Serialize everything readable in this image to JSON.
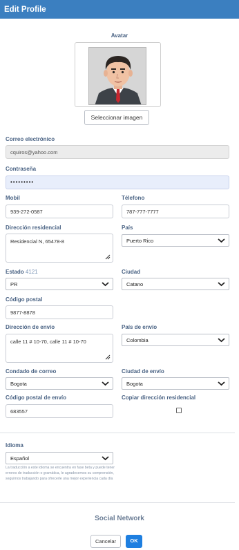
{
  "header": {
    "title": "Edit Profile"
  },
  "avatar": {
    "label": "Avatar",
    "select_button": "Seleccionar imagen"
  },
  "email": {
    "label": "Correo electrónico",
    "value": "cquiros@yahoo.com"
  },
  "password": {
    "label": "Contraseña",
    "value": "•••••••••"
  },
  "mobile": {
    "label": "Mobil",
    "value": "939-272-0587"
  },
  "phone": {
    "label": "Télefono",
    "value": "787-777-7777"
  },
  "residential_address": {
    "label": "Dirección residencial",
    "value": "Residencial N, 65478-8"
  },
  "country": {
    "label": "País",
    "value": "Puerto Rico"
  },
  "state": {
    "label": "Estado",
    "count": "4121",
    "value": "PR"
  },
  "city": {
    "label": "Ciudad",
    "value": "Catano"
  },
  "postal_code": {
    "label": "Código postal",
    "value": "9877-8878"
  },
  "shipping_address": {
    "label": "Dirección de envío",
    "value": "calle 11 # 10-70, calle 11 # 10-70"
  },
  "shipping_country": {
    "label": "País de envío",
    "value": "Colombia"
  },
  "mail_county": {
    "label": "Condado de correo",
    "value": "Bogota"
  },
  "shipping_city": {
    "label": "Ciudad de envío",
    "value": "Bogota"
  },
  "shipping_postal_code": {
    "label": "Código postal de envío",
    "value": "683557"
  },
  "copy_address": {
    "label": "Copiar dirección residencial",
    "checked": false
  },
  "language": {
    "label": "Idioma",
    "value": "Español",
    "note": "La traducción a este idioma se encuentra en fase beta y puede tener errores de traducción o gramática, le agradecemos su comprensión, seguimos trabajando para ofrecerle una mejor experiencia cada día"
  },
  "social": {
    "title": "Social Network"
  },
  "actions": {
    "cancel": "Cancelar",
    "ok": "OK"
  },
  "colors": {
    "header_bg": "#3b7fc0",
    "primary_button": "#1e7fe0",
    "label": "#4a6384"
  }
}
